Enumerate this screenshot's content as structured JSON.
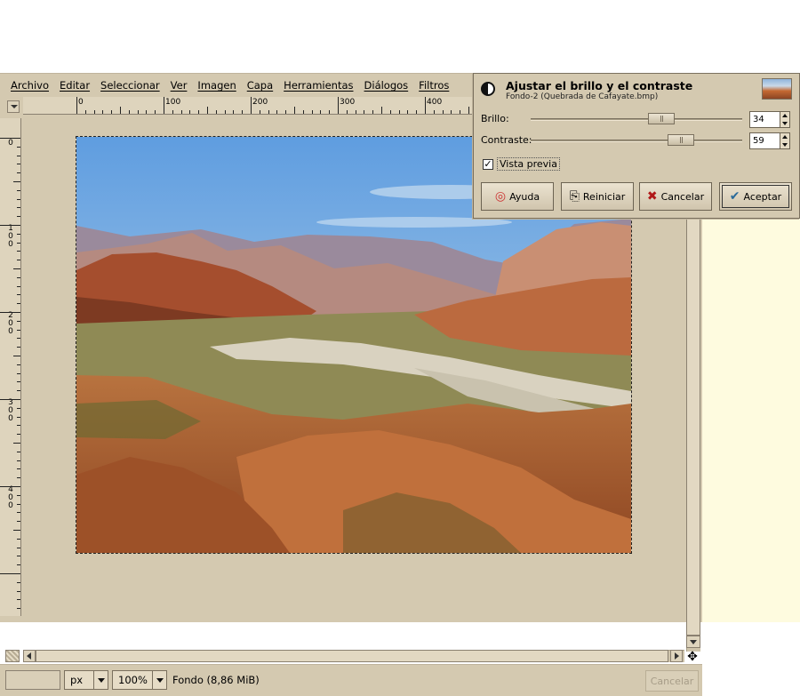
{
  "menubar": {
    "items": [
      "Archivo",
      "Editar",
      "Seleccionar",
      "Ver",
      "Imagen",
      "Capa",
      "Herramientas",
      "Diálogos",
      "Filtros"
    ]
  },
  "rulers": {
    "horizontal_labels": [
      "0",
      "100",
      "200",
      "300",
      "400"
    ],
    "vertical_labels": [
      "0",
      "100",
      "200",
      "300",
      "400"
    ]
  },
  "statusbar": {
    "unit": "px",
    "zoom": "100%",
    "layer_info": "Fondo (8,86 MiB)",
    "cancel_label": "Cancelar"
  },
  "dialog": {
    "title": "Ajustar el brillo y el contraste",
    "subtitle": "Fondo-2 (Quebrada de Cafayate.bmp)",
    "brightness_label": "Brillo:",
    "brightness_value": "34",
    "contrast_label": "Contraste:",
    "contrast_value": "59",
    "preview_label": "Vista previa",
    "preview_checked": true,
    "buttons": {
      "help": "Ayuda",
      "reset": "Reiniciar",
      "cancel": "Cancelar",
      "ok": "Aceptar"
    }
  },
  "colors": {
    "window_bg": "#d4c9b0",
    "side_pane": "#fefbdf"
  }
}
